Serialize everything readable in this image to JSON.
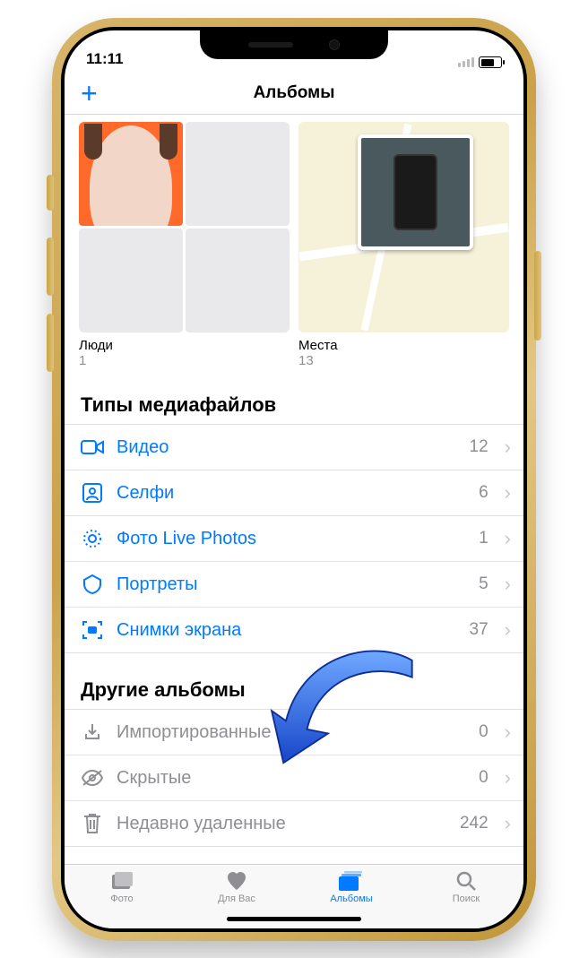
{
  "status": {
    "time": "11:11"
  },
  "header": {
    "title": "Альбомы",
    "add_icon": "plus-icon"
  },
  "albums_preview": [
    {
      "name": "Люди",
      "count": "1"
    },
    {
      "name": "Места",
      "count": "13"
    }
  ],
  "sections": {
    "media_types": {
      "title": "Типы медиафайлов",
      "rows": [
        {
          "icon": "video-icon",
          "label": "Видео",
          "count": "12"
        },
        {
          "icon": "selfie-icon",
          "label": "Селфи",
          "count": "6"
        },
        {
          "icon": "livephoto-icon",
          "label": "Фото Live Photos",
          "count": "1"
        },
        {
          "icon": "portrait-icon",
          "label": "Портреты",
          "count": "5"
        },
        {
          "icon": "screenshot-icon",
          "label": "Снимки экрана",
          "count": "37"
        }
      ]
    },
    "other": {
      "title": "Другие альбомы",
      "rows": [
        {
          "icon": "import-icon",
          "label": "Импортированные",
          "count": "0"
        },
        {
          "icon": "hidden-icon",
          "label": "Скрытые",
          "count": "0"
        },
        {
          "icon": "trash-icon",
          "label": "Недавно удаленные",
          "count": "242"
        }
      ]
    }
  },
  "tabs": [
    {
      "icon": "photos-tab-icon",
      "label": "Фото"
    },
    {
      "icon": "foryou-tab-icon",
      "label": "Для Вас"
    },
    {
      "icon": "albums-tab-icon",
      "label": "Альбомы"
    },
    {
      "icon": "search-tab-icon",
      "label": "Поиск"
    }
  ],
  "active_tab_index": 2,
  "accent": "#007aff"
}
